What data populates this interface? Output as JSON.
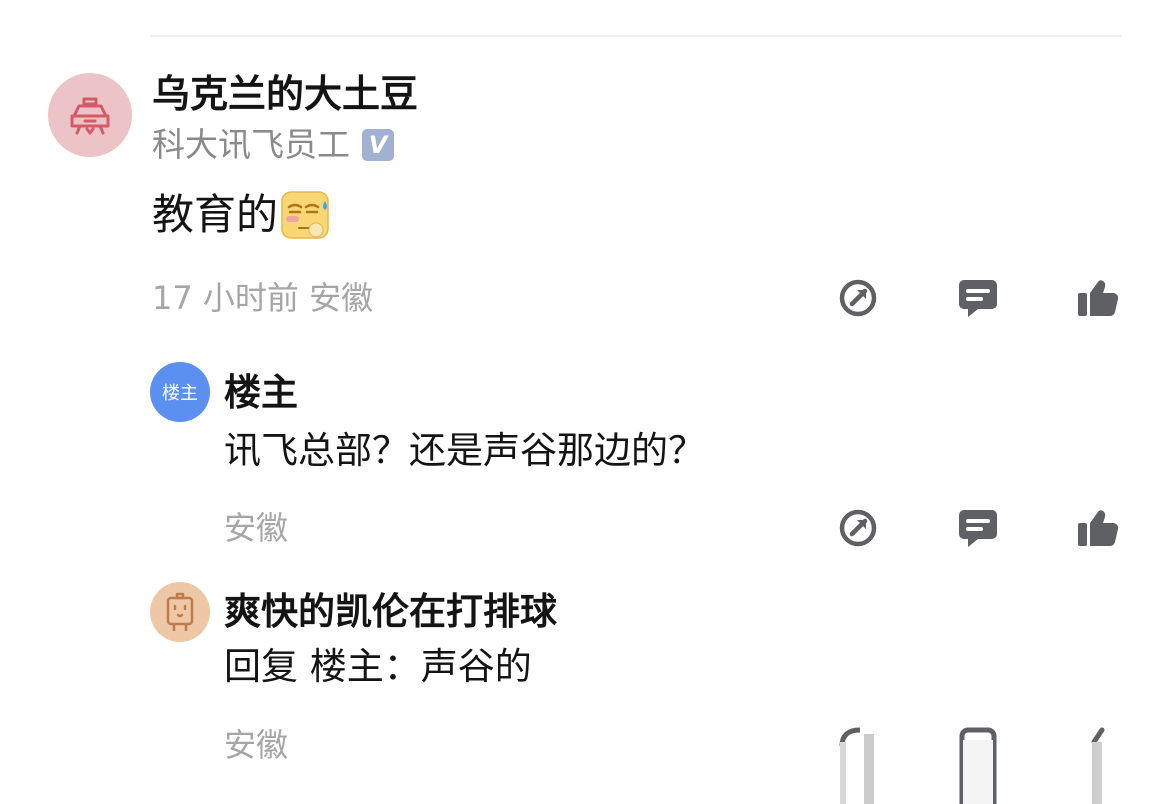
{
  "comment": {
    "username": "乌克兰的大土豆",
    "user_title": "科大讯飞员工",
    "verified_badge": "V",
    "text": "教育的",
    "emoji": "sweat-emoji",
    "meta": "17 小时前  安徽",
    "actions": [
      "share-icon",
      "comment-icon",
      "like-icon"
    ]
  },
  "replies": [
    {
      "avatar_text": "楼主",
      "name": "楼主",
      "text": "讯飞总部？还是声谷那边的？",
      "meta": "安徽"
    },
    {
      "name": "爽快的凯伦在打排球",
      "text": "回复 楼主：声谷的",
      "meta": "安徽"
    }
  ],
  "colors": {
    "icon": "#5f6063",
    "secondary_text": "#8a8a8a",
    "meta_text": "#a6a6a6",
    "host_avatar": "#5b8ff0"
  }
}
